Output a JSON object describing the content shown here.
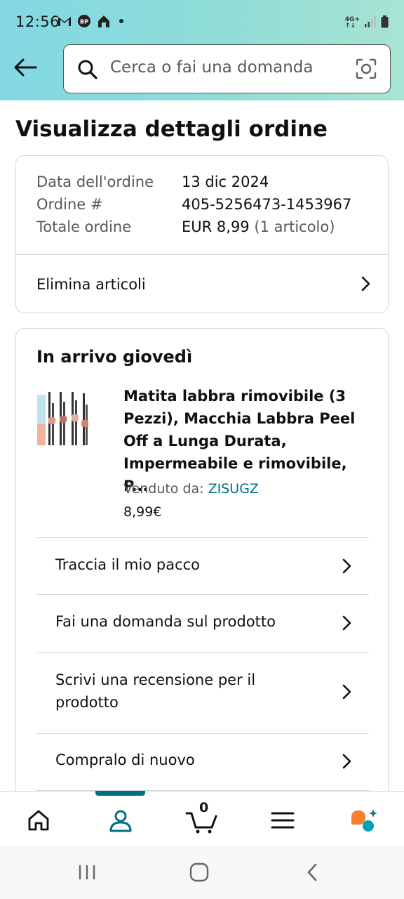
{
  "status_bar": {
    "time": "12:56",
    "left_icons": [
      "gmail-icon",
      "bp-app-icon",
      "home-app-icon",
      "notification-dot"
    ],
    "network": "4G+",
    "right_icons": [
      "network-4g-icon",
      "signal-icon",
      "battery-icon"
    ]
  },
  "header": {
    "back_icon": "arrow-left-icon",
    "search_placeholder": "Cerca o fai una domanda",
    "camera_icon": "camera-lens-icon"
  },
  "page": {
    "title": "Visualizza dettagli ordine"
  },
  "summary": {
    "rows": [
      {
        "label": "Data dell'ordine",
        "value": "13 dic 2024"
      },
      {
        "label": "Ordine #",
        "value": "405-5256473-1453967"
      },
      {
        "label": "Totale ordine",
        "value": "EUR 8,99",
        "extra": "(1 articolo)"
      }
    ],
    "delete_items": "Elimina articoli"
  },
  "order": {
    "arrival": "In arrivo giovedì",
    "product_title": "Matita labbra rimovibile (3 Pezzi), Macchia Labbra Peel Off a Lunga Durata, Impermeabile e rimovibile, P...",
    "sold_by_label": "Venduto da:",
    "seller": "ZISUGZ",
    "price": "8,99€",
    "actions": [
      "Traccia il mio pacco",
      "Fai una domanda sul prodotto",
      "Scrivi una recensione per il prodotto",
      "Compralo di nuovo"
    ]
  },
  "bottom_nav": {
    "items": [
      "home-icon",
      "account-icon",
      "cart-icon",
      "menu-icon",
      "rufus-assistant-icon"
    ],
    "active": "account-icon",
    "cart_count": "0"
  },
  "colors": {
    "accent": "#007185",
    "header_gradient_start": "#82d8e3",
    "header_gradient_end": "#a8e4d4",
    "rufus_orange": "#f77f2a"
  }
}
